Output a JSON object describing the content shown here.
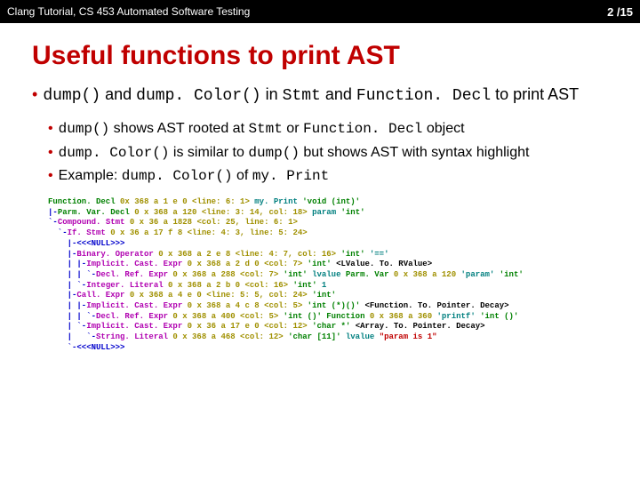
{
  "header": {
    "left": "Clang Tutorial, CS 453 Automated Software Testing",
    "right": "2 /15"
  },
  "title": "Useful functions to print AST",
  "b1": {
    "t1": "dump()",
    "t2": " and ",
    "t3": "dump. Color()",
    "t4": " in ",
    "t5": "Stmt",
    "t6": " and ",
    "t7": "Function. Decl",
    "t8": " to print AST"
  },
  "b2": {
    "a1": "dump()",
    "a2": " shows AST rooted at ",
    "a3": "Stmt",
    "a4": " or ",
    "a5": "Function. Decl",
    "a6": " object",
    "b1": "dump. Color()",
    "b2": " is similar to ",
    "b3": "dump()",
    "b4": " but shows AST with syntax highlight",
    "c1": "Example: ",
    "c2": "dump. Color()",
    "c3": " of ",
    "c4": "my. Print"
  },
  "code": {
    "l01a": "Function. Decl",
    "l01b": " 0x 368 a 1 e 0",
    "l01c": " <line: 6: 1>",
    "l01d": " my. Print",
    "l01e": " 'void (int)'",
    "l02a": "|-",
    "l02b": "Parm. Var. Decl",
    "l02c": " 0 x 368 a 120",
    "l02d": " <line: 3: 14, col: 18>",
    "l02e": " param",
    "l02f": " 'int'",
    "l03a": "`-",
    "l03b": "Compound. Stmt",
    "l03c": " 0 x 36 a 1828",
    "l03d": " <col: 25, line: 6: 1>",
    "l04a": "  `-",
    "l04b": "If. Stmt",
    "l04c": " 0 x 36 a 17 f 8",
    "l04d": " <line: 4: 3, line: 5: 24>",
    "l05a": "    |-",
    "l05b": "<<<NULL>>>",
    "l06a": "    |-",
    "l06b": "Binary. Operator",
    "l06c": " 0 x 368 a 2 e 8",
    "l06d": " <line: 4: 7, col: 16>",
    "l06e": " 'int'",
    "l06f": " '=='",
    "l07a": "    | |-",
    "l07b": "Implicit. Cast. Expr",
    "l07c": " 0 x 368 a 2 d 0",
    "l07d": " <col: 7>",
    "l07e": " 'int'",
    "l07f": " <LValue. To. RValue>",
    "l08a": "    | | `-",
    "l08b": "Decl. Ref. Expr",
    "l08c": " 0 x 368 a 288",
    "l08d": " <col: 7>",
    "l08e": " 'int'",
    "l08f": " lvalue",
    "l08g": " Parm. Var",
    "l08h": " 0 x 368 a 120",
    "l08i": " 'param'",
    "l08j": " 'int'",
    "l09a": "    | `-",
    "l09b": "Integer. Literal",
    "l09c": " 0 x 368 a 2 b 0",
    "l09d": " <col: 16>",
    "l09e": " 'int'",
    "l09f": " 1",
    "l10a": "    |-",
    "l10b": "Call. Expr",
    "l10c": " 0 x 368 a 4 e 0",
    "l10d": " <line: 5: 5, col: 24>",
    "l10e": " 'int'",
    "l11a": "    | |-",
    "l11b": "Implicit. Cast. Expr",
    "l11c": " 0 x 368 a 4 c 8",
    "l11d": " <col: 5>",
    "l11e": " 'int (*)()'",
    "l11f": " <Function. To. Pointer. Decay>",
    "l12a": "    | | `-",
    "l12b": "Decl. Ref. Expr",
    "l12c": " 0 x 368 a 400",
    "l12d": " <col: 5>",
    "l12e": " 'int ()'",
    "l12f": " Function",
    "l12g": " 0 x 368 a 360",
    "l12h": " 'printf'",
    "l12i": " 'int ()'",
    "l13a": "    | `-",
    "l13b": "Implicit. Cast. Expr",
    "l13c": " 0 x 36 a 17 e 0",
    "l13d": " <col: 12>",
    "l13e": " 'char *'",
    "l13f": " <Array. To. Pointer. Decay>",
    "l14a": "    |   `-",
    "l14b": "String. Literal",
    "l14c": " 0 x 368 a 468",
    "l14d": " <col: 12>",
    "l14e": " 'char [11]'",
    "l14f": " lvalue",
    "l14g": " \"param is 1\"",
    "l15a": "    `-",
    "l15b": "<<<NULL>>>"
  }
}
